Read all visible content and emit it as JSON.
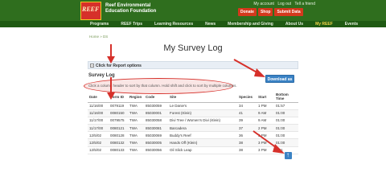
{
  "header": {
    "logo_text": "REEF",
    "org_line1": "Reef Environmental",
    "org_line2": "Education Foundation",
    "account_links": [
      "My account",
      "Log out",
      "Tell a friend"
    ],
    "buttons": [
      "Donate",
      "Shop",
      "Submit Data"
    ],
    "nav": [
      "Programs",
      "REEF Trips",
      "Learning Resources",
      "News",
      "Membership and Giving",
      "About Us",
      "My REEF",
      "Events"
    ],
    "active_nav": "My REEF"
  },
  "breadcrumb": "Home  »  DS",
  "page_title": "My Survey Log",
  "report_options": "Click for Report options",
  "survey_log_label": "Survey Log",
  "download_label": "Download as .csv",
  "hint": "Click a column header to sort by that column. Hold shift and click to sort by multiple columns.",
  "table": {
    "headers": [
      "Date",
      "Form ID",
      "Region",
      "Code",
      "Site",
      "Species",
      "Start",
      "Bottom Time"
    ],
    "rows": [
      [
        "11/16/00",
        "0079119",
        "TWA",
        "85030059",
        "Le Danie's",
        "34",
        "1 PM",
        "01:57"
      ],
      [
        "11/16/00",
        "0080150",
        "TWA",
        "85030001",
        "Forest (Klein)",
        "41",
        "9 AM",
        "01:00"
      ],
      [
        "11/17/00",
        "0079575",
        "TWA",
        "85030058",
        "Divi Tree / Women's Divi (Klein)",
        "39",
        "9 AM",
        "01:00"
      ],
      [
        "11/17/00",
        "0080121",
        "TWA",
        "85030081",
        "Barcadera",
        "37",
        "2 PM",
        "01:00"
      ],
      [
        "12/5/02",
        "0080128",
        "TWA",
        "85030069",
        "Buddy's Reef",
        "36",
        "3 PM",
        "01:00"
      ],
      [
        "12/5/02",
        "0080132",
        "TWA",
        "85030005",
        "Hands Off (Klein)",
        "38",
        "3 PM",
        "01:00"
      ],
      [
        "12/5/02",
        "0080133",
        "TWA",
        "85030056",
        "Oil Slick Leap",
        "38",
        "3 PM",
        "0:51"
      ]
    ]
  },
  "colors": {
    "header_green": "#2f6e1e",
    "button_red": "#d4391d",
    "annotation_red": "#d6302a",
    "download_blue": "#3a82c4"
  }
}
